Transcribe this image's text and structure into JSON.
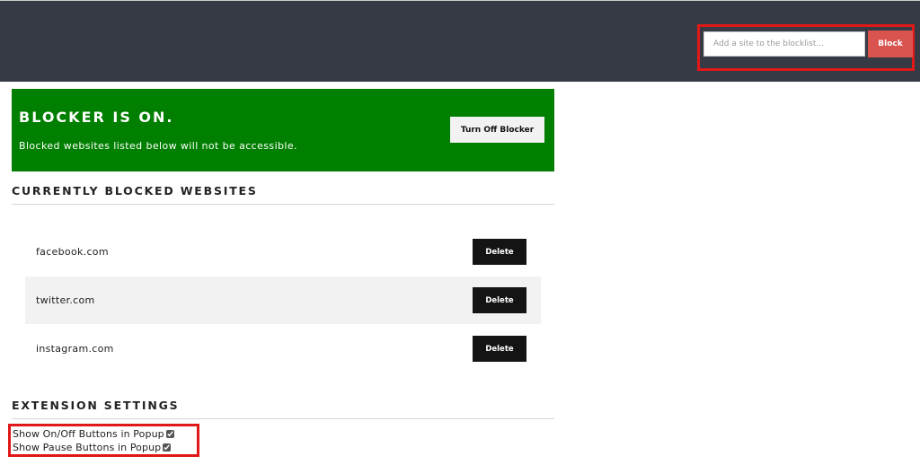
{
  "header": {
    "site_input_placeholder": "Add a site to the blocklist...",
    "site_input_value": "",
    "block_button_label": "Block",
    "background_color": "#363a45",
    "block_button_color": "#d9534f"
  },
  "status": {
    "title": "BLOCKER IS ON.",
    "description": "Blocked websites listed below will not be accessible.",
    "toggle_button_label": "Turn Off Blocker",
    "banner_color": "#007f00"
  },
  "blocked_section": {
    "heading": "CURRENTLY BLOCKED WEBSITES",
    "sites": [
      {
        "name": "facebook.com",
        "delete_label": "Delete"
      },
      {
        "name": "twitter.com",
        "delete_label": "Delete"
      },
      {
        "name": "instagram.com",
        "delete_label": "Delete"
      }
    ]
  },
  "settings_section": {
    "heading": "EXTENSION SETTINGS",
    "options": [
      {
        "label": "Show On/Off Buttons in Popup",
        "checked": true
      },
      {
        "label": "Show Pause Buttons in Popup",
        "checked": true
      }
    ]
  }
}
